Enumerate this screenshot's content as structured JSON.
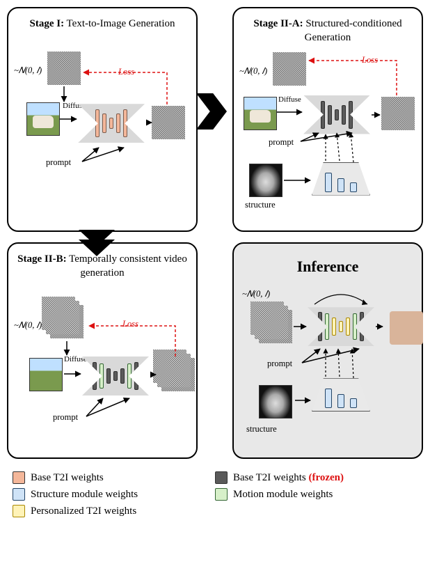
{
  "stage1": {
    "title_bold": "Stage I:",
    "title_rest": " Text-to-Image Generation",
    "noise_label": "~𝑁(0, 𝐼)",
    "diffuse_label": "Diffuse",
    "prompt_label": "prompt",
    "loss_label": "Loss"
  },
  "stage2a": {
    "title_bold": "Stage II-A:",
    "title_rest": " Structured-conditioned Generation",
    "noise_label": "~𝑁(0, 𝐼)",
    "diffuse_label": "Diffuse",
    "prompt_label": "prompt",
    "structure_label": "structure",
    "loss_label": "Loss"
  },
  "stage2b": {
    "title_bold": "Stage II-B:",
    "title_rest": " Temporally consistent video generation",
    "noise_label": "~𝑁(0, 𝐼)",
    "diffuse_label": "Diffuse",
    "prompt_label": "prompt",
    "loss_label": "Loss"
  },
  "inference": {
    "title": "Inference",
    "noise_label": "~𝑁(0, 𝐼)",
    "prompt_label": "prompt",
    "structure_label": "structure"
  },
  "legend": {
    "base": "Base T2I weights",
    "base_frozen_pre": "Base T2I weights ",
    "base_frozen_tag": "(frozen)",
    "struct": "Structure module weights",
    "motion": "Motion module weights",
    "pers": "Personalized T2I weights"
  }
}
